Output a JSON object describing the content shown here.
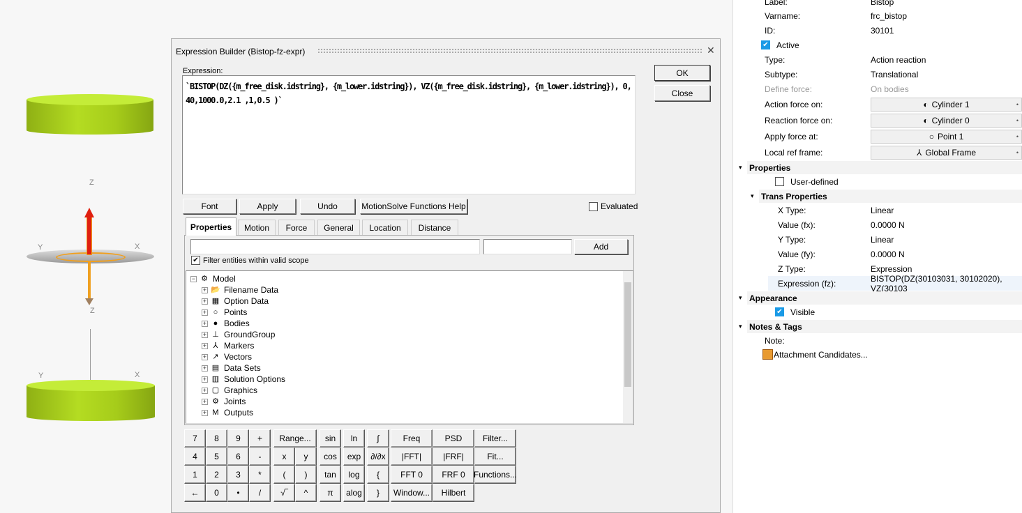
{
  "viewport": {
    "axis_z_top": "Z",
    "axis_y": "Y",
    "axis_x": "X",
    "axis_z_bottom": "Z",
    "axis_y2": "Y",
    "axis_x2": "X"
  },
  "dialog": {
    "title": "Expression Builder (Bistop-fz-expr)",
    "expression_label": "Expression:",
    "expression": "`BISTOP(DZ({m_free_disk.idstring}, {m_lower.idstring}), VZ({m_free_disk.idstring}, {m_lower.idstring}), 0,40,1000.0,2.1 ,1,0.5 )`",
    "ok": "OK",
    "close": "Close",
    "font": "Font",
    "apply": "Apply",
    "undo": "Undo",
    "help": "MotionSolve Functions Help",
    "evaluated": "Evaluated",
    "tabs": [
      "Properties",
      "Motion",
      "Force",
      "General",
      "Location",
      "Distance"
    ],
    "add": "Add",
    "filter_label": "Filter entities within valid scope",
    "tree_root": "Model",
    "tree": [
      "Filename Data",
      "Option Data",
      "Points",
      "Bodies",
      "GroundGroup",
      "Markers",
      "Vectors",
      "Data Sets",
      "Solution Options",
      "Graphics",
      "Joints",
      "Outputs"
    ],
    "keys": {
      "num": [
        "7",
        "8",
        "9",
        "+",
        "4",
        "5",
        "6",
        "-",
        "1",
        "2",
        "3",
        "*",
        "←",
        "0",
        "•",
        "/"
      ],
      "range": "Range...",
      "x": "x",
      "y": "y",
      "lp": "(",
      "rp": ")",
      "sqrt": "√‾",
      "pow": "^",
      "f1": [
        "sin",
        "cos",
        "tan",
        "π"
      ],
      "f2": [
        "ln",
        "exp",
        "log",
        "alog"
      ],
      "f3": [
        "∫",
        "∂/∂x",
        "{",
        "}"
      ],
      "sig": [
        "Freq",
        "PSD",
        "Filter...",
        "|FFT|",
        "|FRF|",
        "Fit...",
        "FFT 0",
        "FRF 0",
        "Functions...",
        "Window...",
        "Hilbert"
      ]
    }
  },
  "panel": {
    "label_l": "Label:",
    "label_v": "Bistop",
    "varname_l": "Varname:",
    "varname_v": "frc_bistop",
    "id_l": "ID:",
    "id_v": "30101",
    "active": "Active",
    "type_l": "Type:",
    "type_v": "Action reaction",
    "subtype_l": "Subtype:",
    "subtype_v": "Translational",
    "define_l": "Define force:",
    "define_v": "On bodies",
    "action_l": "Action force on:",
    "action_v": "Cylinder 1",
    "reaction_l": "Reaction force on:",
    "reaction_v": "Cylinder 0",
    "apply_l": "Apply force at:",
    "apply_v": "Point 1",
    "ref_l": "Local ref frame:",
    "ref_v": "Global Frame",
    "properties": "Properties",
    "user_defined": "User-defined",
    "trans": "Trans Properties",
    "xt_l": "X Type:",
    "xt_v": "Linear",
    "fx_l": "Value (fx):",
    "fx_v": "0.0000 N",
    "yt_l": "Y Type:",
    "yt_v": "Linear",
    "fy_l": "Value (fy):",
    "fy_v": "0.0000 N",
    "zt_l": "Z Type:",
    "zt_v": "Expression",
    "fz_l": "Expression (fz):",
    "fz_v": "BISTOP(DZ(30103031, 30102020), VZ(30103",
    "appearance": "Appearance",
    "visible": "Visible",
    "notes": "Notes & Tags",
    "note_l": "Note:",
    "attach": "Attachment Candidates..."
  }
}
